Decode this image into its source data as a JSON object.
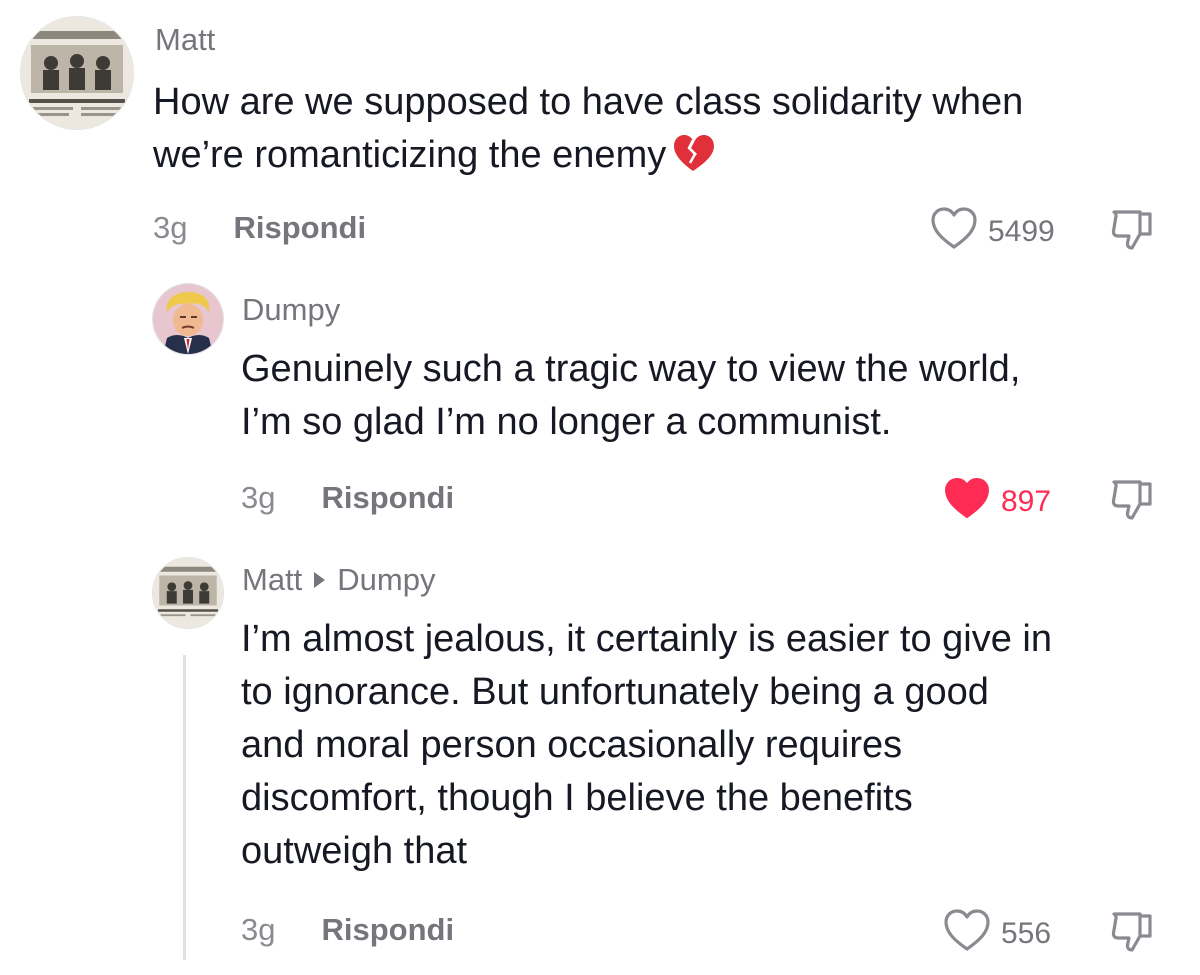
{
  "comments": [
    {
      "username": "Matt",
      "text_line1": "How are we supposed to have class solidarity when",
      "text_line2": "we’re romanticizing the enemy",
      "time": "3g",
      "reply_label": "Rispondi",
      "likes": "5499",
      "liked": false
    },
    {
      "username": "Dumpy",
      "text_line1": "Genuinely such a tragic way to view the world,",
      "text_line2": "I’m so glad I’m no longer a communist.",
      "time": "3g",
      "reply_label": "Rispondi",
      "likes": "897",
      "liked": true
    },
    {
      "username": "Matt",
      "reply_to": "Dumpy",
      "lines": [
        "I’m almost jealous, it certainly is easier to give in",
        "to ignorance. But unfortunately being a good",
        "and moral person occasionally requires",
        "discomfort, though I believe the benefits",
        "outweigh that"
      ],
      "time": "3g",
      "reply_label": "Rispondi",
      "likes": "556",
      "liked": false
    }
  ],
  "colors": {
    "like_active": "#fe2c55",
    "muted_text": "#75767b",
    "primary_text": "#161823"
  },
  "icons": {
    "like": "heart-outline-icon",
    "liked": "heart-filled-icon",
    "dislike": "thumbs-down-icon",
    "emoji": "broken-heart-emoji-icon"
  }
}
